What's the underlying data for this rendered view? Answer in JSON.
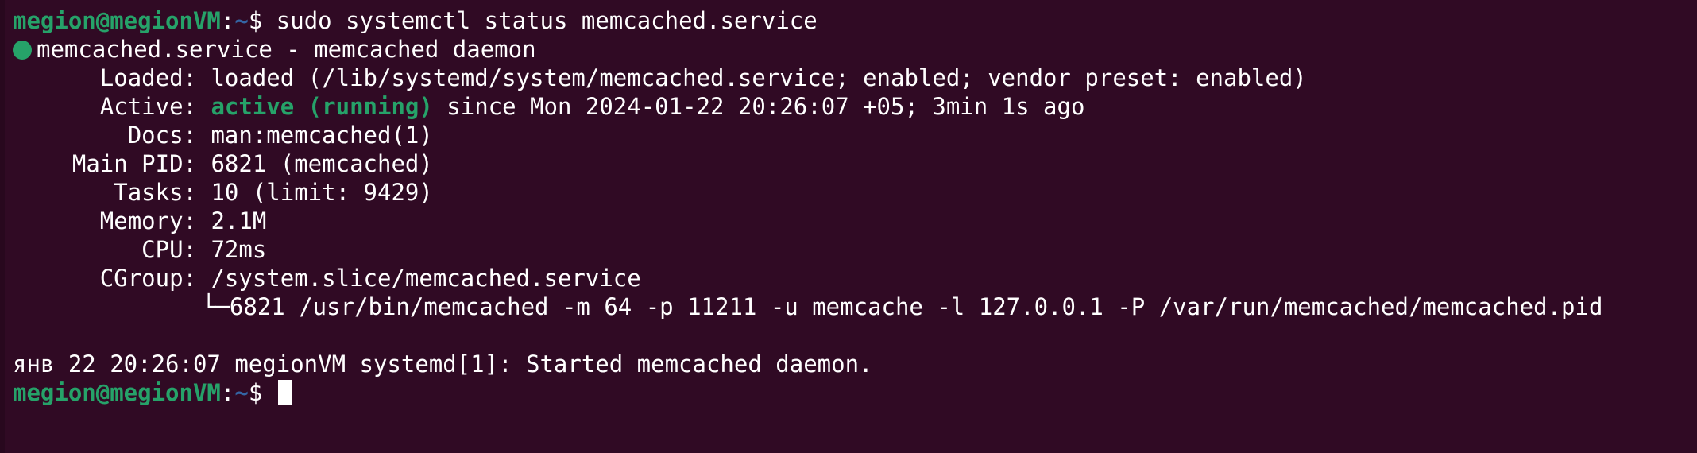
{
  "prompt": {
    "user_host": "megion@megionVM",
    "colon": ":",
    "path": "~",
    "dollar": "$"
  },
  "command": " sudo systemctl status memcached.service",
  "unit_line": "memcached.service - memcached daemon",
  "fields": [
    {
      "key": "Loaded:",
      "value": "loaded (/lib/systemd/system/memcached.service; enabled; vendor preset: enabled)"
    },
    {
      "key": "Active:",
      "status": "active (running)",
      "value": " since Mon 2024-01-22 20:26:07 +05; 3min 1s ago"
    },
    {
      "key": "Docs:",
      "value": "man:memcached(1)"
    },
    {
      "key": "Main PID:",
      "value": "6821 (memcached)"
    },
    {
      "key": "Tasks:",
      "value": "10 (limit: 9429)"
    },
    {
      "key": "Memory:",
      "value": "2.1M"
    },
    {
      "key": "CPU:",
      "value": "72ms"
    },
    {
      "key": "CGroup:",
      "value": "/system.slice/memcached.service"
    }
  ],
  "cgroup_tree": "└─6821 /usr/bin/memcached -m 64 -p 11211 -u memcache -l 127.0.0.1 -P /var/run/memcached/memcached.pid",
  "log_line": "янв 22 20:26:07 megionVM systemd[1]: Started memcached daemon.",
  "colors": {
    "background": "#300a24",
    "prompt_user": "#26a269",
    "prompt_path": "#3465a4",
    "active": "#26a269",
    "text": "#ffffff"
  },
  "icons": {
    "status_dot": "green-circle-icon"
  }
}
